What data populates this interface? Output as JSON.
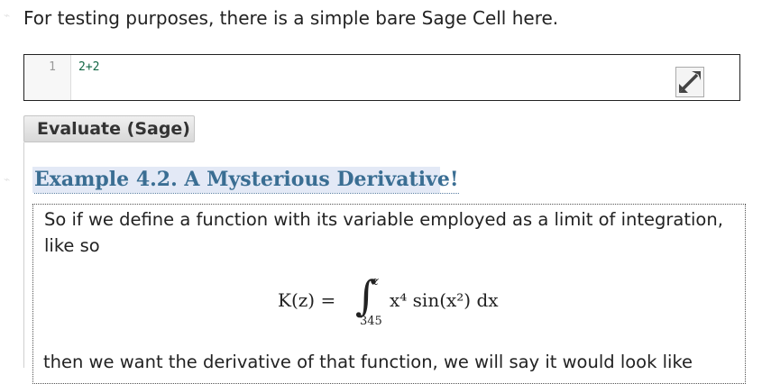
{
  "intro": {
    "text": "For testing purposes, there is a simple bare Sage Cell here."
  },
  "sage_cell": {
    "line_number": "1",
    "code": "2+2",
    "expand_icon": "expand-arrows-icon",
    "evaluate_label": "Evaluate (Sage)"
  },
  "example": {
    "title": "Example 4.2. A Mysterious Derivative!",
    "body": "So if we define a function with its variable employed as a limit of integration, like so",
    "formula": {
      "lhs": "K(z) = ",
      "upper_limit": "z",
      "lower_limit": "345",
      "integrand": "x⁴ sin(x²) dx"
    },
    "continuation": "then we want the derivative of that function, we will say it would look like"
  },
  "colors": {
    "title_text": "#3a6e93",
    "title_background": "#e3e9f6",
    "code_text": "#116644"
  }
}
